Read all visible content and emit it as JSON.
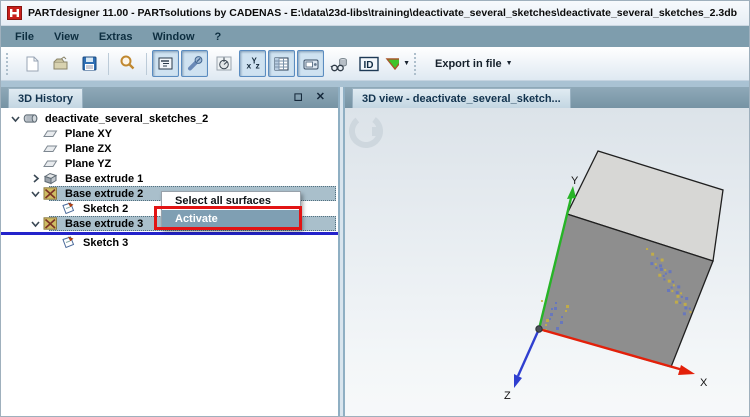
{
  "window": {
    "title": "PARTdesigner 11.00 - PARTsolutions by CADENAS - E:\\data\\23d-libs\\training\\deactivate_several_sketches\\deactivate_several_sketches_2.3db"
  },
  "menubar": {
    "items": [
      "File",
      "View",
      "Extras",
      "Window",
      "?"
    ]
  },
  "toolbar": {
    "export_label": "Export in file",
    "items": [
      {
        "type": "handle"
      },
      {
        "type": "button",
        "icon": "new-file-icon"
      },
      {
        "type": "button",
        "icon": "open-folder-icon"
      },
      {
        "type": "button",
        "icon": "save-icon"
      },
      {
        "type": "sep"
      },
      {
        "type": "button",
        "icon": "magnifier-icon"
      },
      {
        "type": "sep"
      },
      {
        "type": "button",
        "icon": "history-panel-icon",
        "pressed": true
      },
      {
        "type": "button",
        "icon": "screw-icon",
        "pressed": true
      },
      {
        "type": "button",
        "icon": "sketch-circle-icon"
      },
      {
        "type": "button",
        "icon": "xyz-axes-icon",
        "pressed": true
      },
      {
        "type": "button",
        "icon": "table-icon",
        "pressed": true
      },
      {
        "type": "button",
        "icon": "camera-view-icon",
        "pressed": true
      },
      {
        "type": "button",
        "icon": "assembly-glasses-icon"
      },
      {
        "type": "button",
        "icon": "id-icon"
      },
      {
        "type": "button",
        "icon": "export-triangle-icon",
        "dropdown": true
      },
      {
        "type": "handle"
      },
      {
        "type": "button",
        "label_key": "export_label",
        "dropdown": true,
        "name": "export-in-file-button"
      }
    ]
  },
  "left_panel": {
    "tab": "3D History",
    "maximize_glyph": "◻",
    "close_glyph": "✕",
    "tree": [
      {
        "label": "deactivate_several_sketches_2",
        "indent": 0,
        "icon": "part-icon",
        "expander": "expanded"
      },
      {
        "label": "Plane XY",
        "indent": 1,
        "icon": "plane-icon"
      },
      {
        "label": "Plane ZX",
        "indent": 1,
        "icon": "plane-icon"
      },
      {
        "label": "Plane YZ",
        "indent": 1,
        "icon": "plane-icon"
      },
      {
        "label": "Base extrude 1",
        "indent": 1,
        "icon": "extrude-icon",
        "expander": "collapsed"
      },
      {
        "label": "Base extrude 2",
        "indent": 1,
        "icon": "deactivated-icon",
        "expander": "expanded",
        "selected": true
      },
      {
        "label": "Sketch 2",
        "indent": 2,
        "icon": "sketch-icon"
      },
      {
        "label": "Base extrude 3",
        "indent": 1,
        "icon": "deactivated-icon",
        "expander": "expanded",
        "selected": true,
        "line_after": true
      },
      {
        "label": "Sketch 3",
        "indent": 2,
        "icon": "sketch-icon"
      }
    ]
  },
  "context_menu": {
    "items": [
      {
        "label": "Select all surfaces"
      },
      {
        "label": "Activate",
        "highlighted": true,
        "annotated": true
      }
    ]
  },
  "right_panel": {
    "tab": "3D view - deactivate_several_sketch...",
    "viewport": {
      "axis_labels": {
        "x": "X",
        "y": "Y",
        "z": "Z"
      },
      "colors": {
        "x_axis": "#e3200a",
        "y_axis": "#27b427",
        "z_axis": "#2f3fd0",
        "cube_top": "#d7d7d5",
        "cube_front": "#8e8e8e"
      }
    }
  },
  "colors": {
    "annotation_red": "#e21414",
    "selection": "#a9bfcb",
    "menu_highlight": "#7f9fb3",
    "insert_line_blue": "#2323cb",
    "menubar": "#7e9dad"
  }
}
